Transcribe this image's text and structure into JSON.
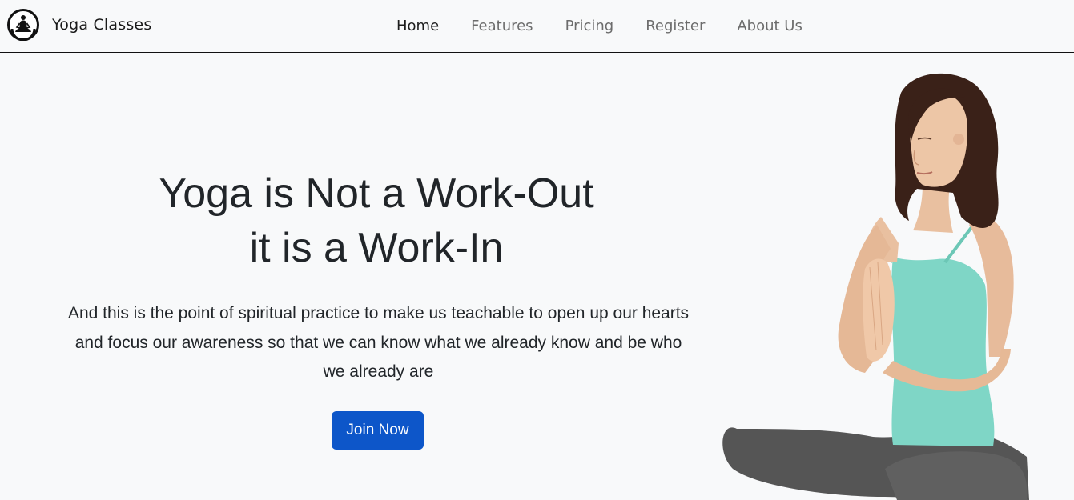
{
  "brand": {
    "name": "Yoga Classes",
    "logo_icon": "meditation-logo-icon"
  },
  "nav": {
    "items": [
      {
        "label": "Home",
        "active": true
      },
      {
        "label": "Features",
        "active": false
      },
      {
        "label": "Pricing",
        "active": false
      },
      {
        "label": "Register",
        "active": false
      },
      {
        "label": "About Us",
        "active": false
      }
    ]
  },
  "hero": {
    "title_line1": "Yoga is Not a Work-Out",
    "title_line2": "it is a Work-In",
    "text": "And this is the point of spiritual practice to make us teachable to open up our hearts and focus our awareness so that we can know what we already know and be who we already are",
    "button_label": "Join Now",
    "image": "woman-meditating-photo"
  },
  "colors": {
    "background": "#f8f9fa",
    "button": "#0d56c9",
    "top_color": "#7fd6c6",
    "pants_color": "#555555",
    "hair_color": "#3a2118"
  }
}
